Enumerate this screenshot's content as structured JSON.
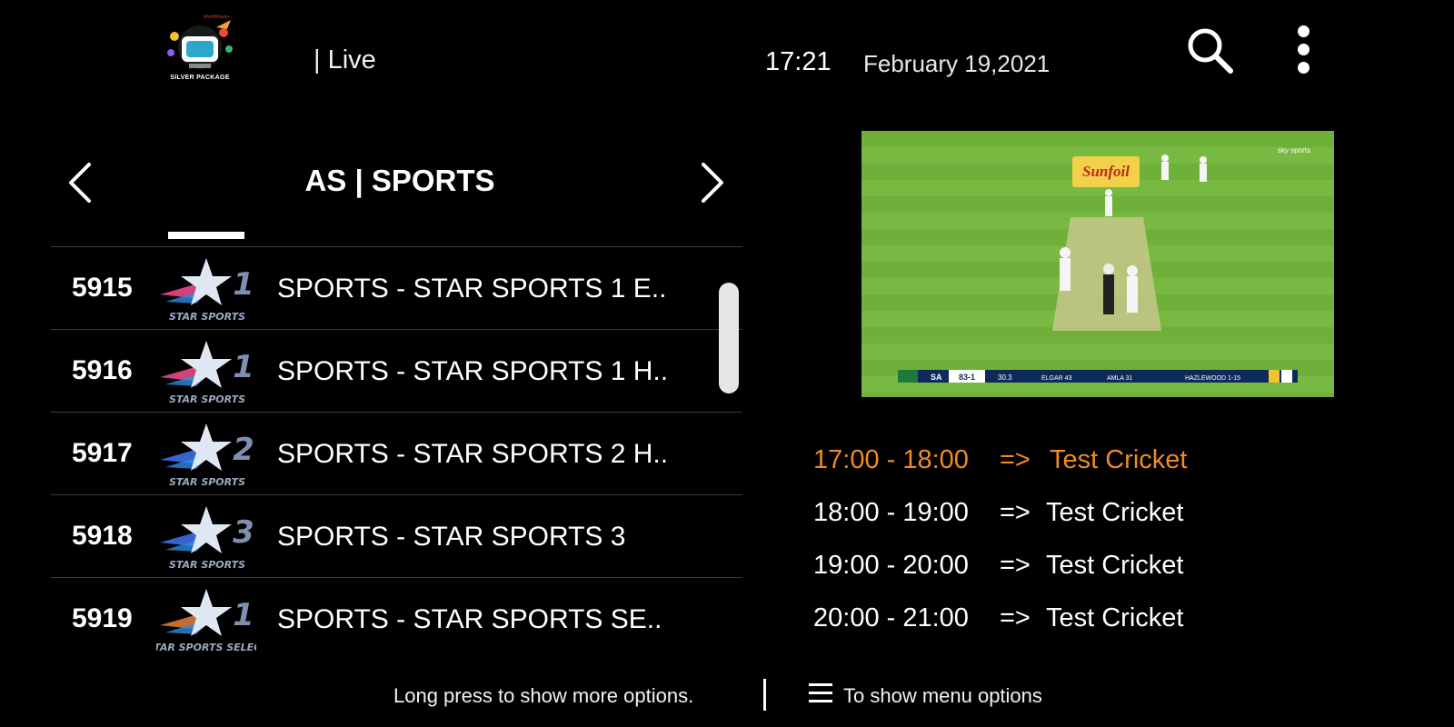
{
  "header": {
    "logo_text": "SILVER PACKAGE",
    "logo_tag": "WorldMaster",
    "section": "Live",
    "time": "17:21",
    "date": "February 19,2021",
    "search_icon": "search-icon",
    "more_icon": "more-vertical-icon"
  },
  "category": {
    "title": "AS | SPORTS",
    "prev_icon": "chevron-left-icon",
    "next_icon": "chevron-right-icon"
  },
  "channels": [
    {
      "number": "5915",
      "name": "SPORTS - STAR SPORTS 1 E..",
      "logo_text": "STAR SPORTS",
      "logo_digit": "1"
    },
    {
      "number": "5916",
      "name": "SPORTS - STAR SPORTS 1 H..",
      "logo_text": "STAR SPORTS",
      "logo_digit": "1"
    },
    {
      "number": "5917",
      "name": "SPORTS - STAR SPORTS 2 H..",
      "logo_text": "STAR SPORTS",
      "logo_digit": "2"
    },
    {
      "number": "5918",
      "name": "SPORTS - STAR SPORTS 3",
      "logo_text": "STAR SPORTS",
      "logo_digit": "3"
    },
    {
      "number": "5919",
      "name": "SPORTS - STAR SPORTS SE..",
      "logo_text": "STAR SPORTS SELECT",
      "logo_digit": "1"
    }
  ],
  "preview": {
    "sponsor": "Sunfoil",
    "broadcaster": "sky sports",
    "score_team": "SA",
    "score": "83-1",
    "overs": "30.3",
    "batter1": "ELGAR 43",
    "batter2": "AMLA 31",
    "bowler": "HAZLEWOOD 1-15"
  },
  "epg": [
    {
      "time": "17:00 - 18:00",
      "arrow": "=>",
      "program": "Test Cricket",
      "current": true
    },
    {
      "time": "18:00 - 19:00",
      "arrow": "=>",
      "program": "Test Cricket",
      "current": false
    },
    {
      "time": "19:00 - 20:00",
      "arrow": "=>",
      "program": "Test Cricket",
      "current": false
    },
    {
      "time": "20:00 - 21:00",
      "arrow": "=>",
      "program": "Test Cricket",
      "current": false
    }
  ],
  "footer": {
    "hint_long_press": "Long press to show more options.",
    "hint_menu": "To show menu options",
    "menu_icon": "menu-icon"
  },
  "colors": {
    "background": "#000000",
    "current_program": "#f08a24",
    "pitch_green": "#6fb03a"
  }
}
